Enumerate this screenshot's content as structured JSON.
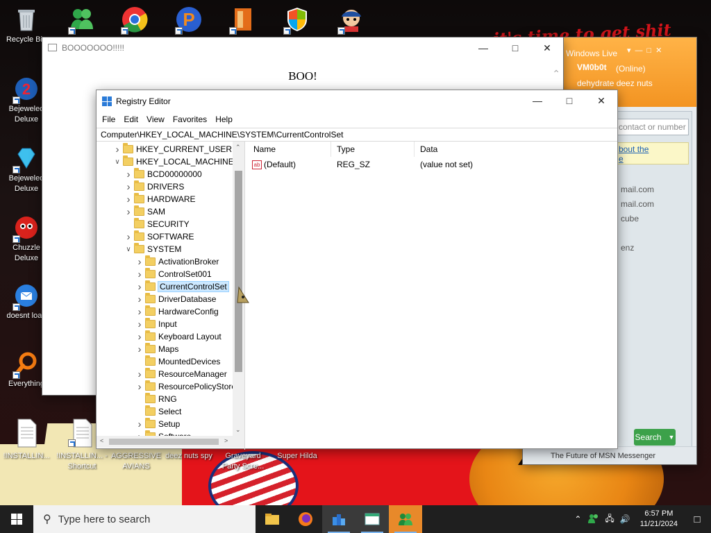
{
  "wallpaper": {
    "text": "it's time to get shit"
  },
  "desktop_icons": [
    {
      "label": "Recycle Bin",
      "icon": "recycle-bin-icon"
    },
    {
      "label": "Bejeweled Deluxe",
      "icon": "bejeweled-icon"
    },
    {
      "label": "Bejeweled Deluxe",
      "icon": "bejeweled-2-icon"
    },
    {
      "label": "Chuzzle Deluxe",
      "icon": "chuzzle-icon"
    },
    {
      "label": "doesnt load",
      "icon": "thunderbird-icon"
    },
    {
      "label": "Everything",
      "icon": "everything-icon"
    },
    {
      "label": "!INSTALLIN...",
      "icon": "text-file-icon"
    },
    {
      "label": "!INSTALLIN... - Shortcut",
      "icon": "text-file-icon"
    },
    {
      "label": "AGGRESSIVE AVIANS",
      "icon": "game-icon"
    },
    {
      "label": "deez nuts spy",
      "icon": "game-icon"
    },
    {
      "label": "Graveyard Party Scre...",
      "icon": "game-icon"
    },
    {
      "label": "Super Hilda",
      "icon": "game-icon"
    }
  ],
  "boo_window": {
    "title": "BOOOOOOO!!!!!",
    "text": "BOO!"
  },
  "msn_window": {
    "title": "Windows Live",
    "username": "VM0b0t",
    "status": "(Online)",
    "personal_message": "dehydrate deez nuts",
    "search_placeholder": "contact or number",
    "notice_line1": "bout the",
    "notice_line2": "e",
    "contacts": [
      "mail.com",
      "mail.com",
      "cube",
      "enz"
    ],
    "search_button": "Search",
    "footer": "The Future of MSN Messenger"
  },
  "registry_editor": {
    "title": "Registry Editor",
    "menu": [
      "File",
      "Edit",
      "View",
      "Favorites",
      "Help"
    ],
    "address": "Computer\\HKEY_LOCAL_MACHINE\\SYSTEM\\CurrentControlSet",
    "tree": [
      {
        "label": "HKEY_CURRENT_USER",
        "level": 0,
        "exp": ">"
      },
      {
        "label": "HKEY_LOCAL_MACHINE",
        "level": 0,
        "exp": "v"
      },
      {
        "label": "BCD00000000",
        "level": 1,
        "exp": ">"
      },
      {
        "label": "DRIVERS",
        "level": 1,
        "exp": ">"
      },
      {
        "label": "HARDWARE",
        "level": 1,
        "exp": ">"
      },
      {
        "label": "SAM",
        "level": 1,
        "exp": ">"
      },
      {
        "label": "SECURITY",
        "level": 1,
        "exp": ""
      },
      {
        "label": "SOFTWARE",
        "level": 1,
        "exp": ">"
      },
      {
        "label": "SYSTEM",
        "level": 1,
        "exp": "v"
      },
      {
        "label": "ActivationBroker",
        "level": 2,
        "exp": ">"
      },
      {
        "label": "ControlSet001",
        "level": 2,
        "exp": ">"
      },
      {
        "label": "CurrentControlSet",
        "level": 2,
        "exp": ">",
        "selected": true
      },
      {
        "label": "DriverDatabase",
        "level": 2,
        "exp": ">"
      },
      {
        "label": "HardwareConfig",
        "level": 2,
        "exp": ">"
      },
      {
        "label": "Input",
        "level": 2,
        "exp": ">"
      },
      {
        "label": "Keyboard Layout",
        "level": 2,
        "exp": ">"
      },
      {
        "label": "Maps",
        "level": 2,
        "exp": ">"
      },
      {
        "label": "MountedDevices",
        "level": 2,
        "exp": ""
      },
      {
        "label": "ResourceManager",
        "level": 2,
        "exp": ">"
      },
      {
        "label": "ResourcePolicyStore",
        "level": 2,
        "exp": ">"
      },
      {
        "label": "RNG",
        "level": 2,
        "exp": ""
      },
      {
        "label": "Select",
        "level": 2,
        "exp": ""
      },
      {
        "label": "Setup",
        "level": 2,
        "exp": ">"
      },
      {
        "label": "Software",
        "level": 2,
        "exp": ">"
      }
    ],
    "columns": [
      "Name",
      "Type",
      "Data"
    ],
    "values": [
      {
        "name": "(Default)",
        "type": "REG_SZ",
        "data": "(value not set)"
      }
    ]
  },
  "taskbar": {
    "search_placeholder": "Type here to search",
    "apps": [
      "file-explorer-icon",
      "firefox-icon",
      "regedit-icon",
      "window-app-icon",
      "msn-icon"
    ],
    "time": "6:57 PM",
    "date": "11/21/2024"
  },
  "colors": {
    "msn_orange": "#f39422",
    "selection": "#cce8ff",
    "taskbar": "#1f1f1f"
  }
}
